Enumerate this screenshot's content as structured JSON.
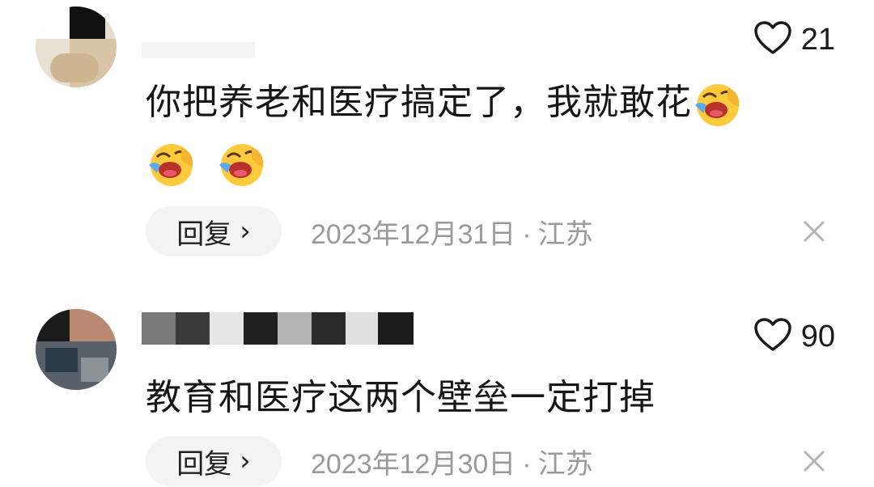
{
  "comments": [
    {
      "text": "你把养老和医疗搞定了，我就敢花",
      "likes": "21",
      "reply_label": "回复",
      "date": "2023年12月31日",
      "location": "江苏",
      "emoji_icon": "face-with-tears-of-joy-icon"
    },
    {
      "text": "教育和医疗这两个壁垒一定打掉",
      "likes": "90",
      "reply_label": "回复",
      "date": "2023年12月30日",
      "location": "江苏"
    }
  ],
  "separator": "·",
  "colors": {
    "meta": "#9a9a9a",
    "reply_bg": "#f4f4f4",
    "text": "#161616"
  }
}
